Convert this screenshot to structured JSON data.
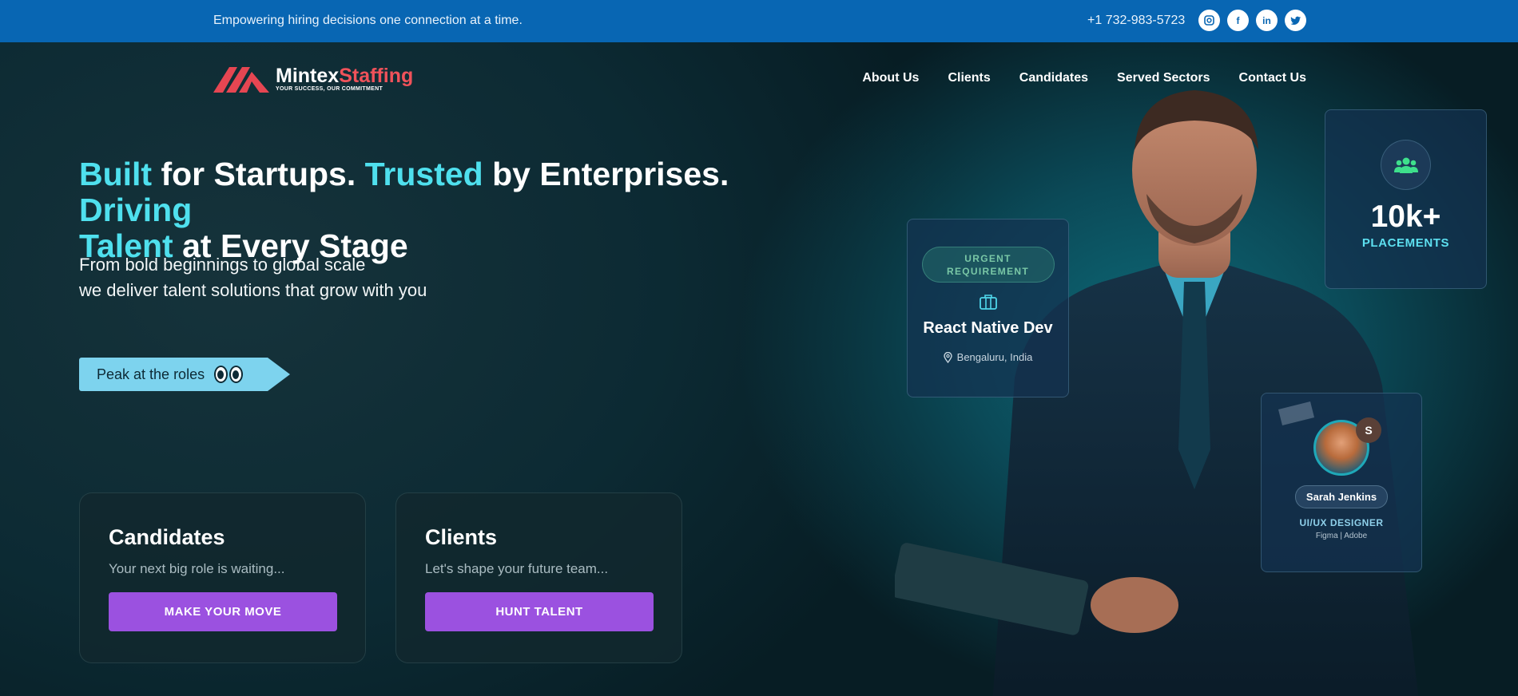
{
  "topbar": {
    "tagline": "Empowering hiring decisions one connection at a time.",
    "phone": "+1 732-983-5723",
    "socials": [
      "instagram-icon",
      "facebook-icon",
      "linkedin-icon",
      "twitter-icon"
    ]
  },
  "brand": {
    "name_part1": "Mintex",
    "name_part2": "Staffing",
    "slogan": "YOUR SUCCESS, OUR COMMITMENT"
  },
  "nav": [
    "About Us",
    "Clients",
    "Candidates",
    "Served Sectors",
    "Contact Us"
  ],
  "hero": {
    "headline": [
      {
        "text": "Built",
        "highlight": true
      },
      {
        "text": " for Startups. ",
        "highlight": false
      },
      {
        "text": "Trusted",
        "highlight": true
      },
      {
        "text": " by Enterprises. ",
        "highlight": false
      },
      {
        "text": "Driving",
        "highlight": true
      },
      {
        "text": " ",
        "highlight": false
      },
      {
        "text": "Talent",
        "highlight": true
      },
      {
        "text": " at Every Stage",
        "highlight": false
      }
    ],
    "sub_line1": "From bold beginnings to global scale",
    "sub_line2": "we deliver talent solutions that grow with you",
    "cta": "Peak at the roles"
  },
  "cards": {
    "candidates": {
      "title": "Candidates",
      "text": "Your next big role is waiting...",
      "button": "MAKE YOUR MOVE"
    },
    "clients": {
      "title": "Clients",
      "text": "Let's shape your future team...",
      "button": "HUNT TALENT"
    }
  },
  "urgent": {
    "badge": "URGENT REQUIREMENT",
    "title": "React Native Dev",
    "location": "Bengaluru, India"
  },
  "stat": {
    "value": "10k+",
    "label": "PLACEMENTS"
  },
  "profile": {
    "initial": "S",
    "name": "Sarah Jenkins",
    "role": "UI/UX DESIGNER",
    "tools": "Figma | Adobe"
  },
  "colors": {
    "topbar": "#0866b3",
    "accent": "#4fe0ee",
    "brand_red": "#f0525a",
    "button": "#9b51e0",
    "cta": "#7dd3ee"
  }
}
